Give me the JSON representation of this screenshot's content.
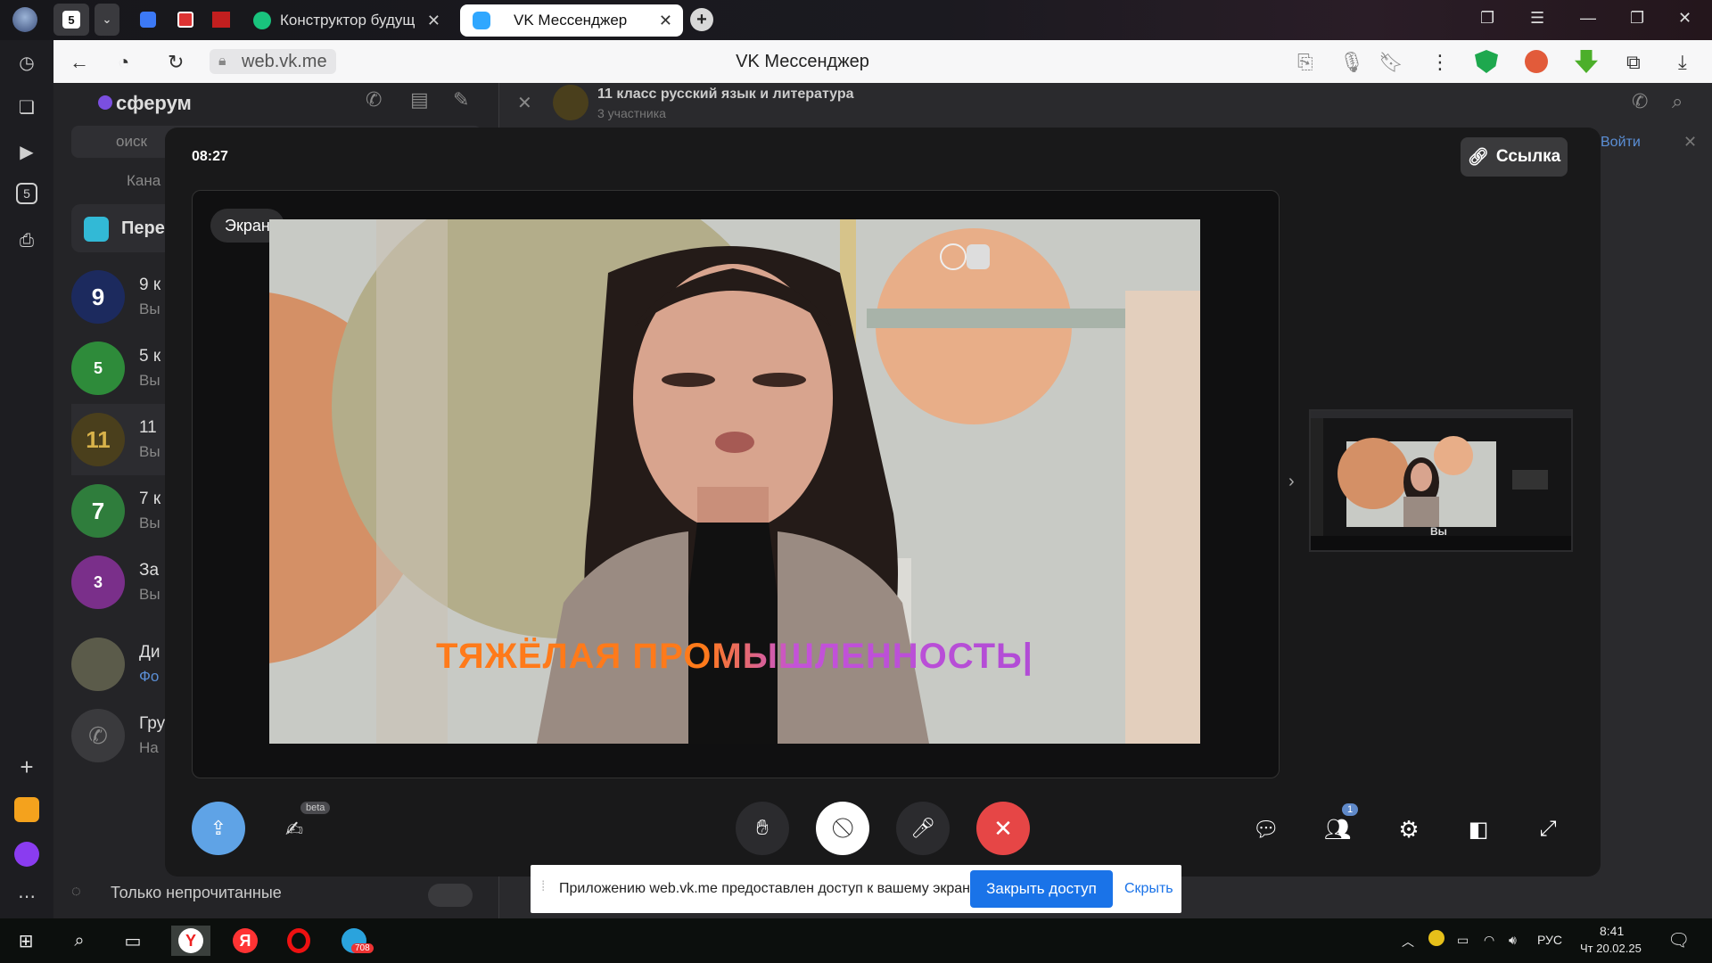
{
  "browser": {
    "tab_counter": "5",
    "tabs": [
      {
        "label": "Конструктор будущ",
        "active": false
      },
      {
        "label": "VK Мессенджер",
        "active": true
      }
    ],
    "address": "web.vk.me",
    "page_title": "VK Мессенджер"
  },
  "vk": {
    "brand": "сферум",
    "search_placeholder": "оиск",
    "chat_title": "11 класс русский язык и литература",
    "chat_members": "3 участника",
    "login_label": "Войти",
    "left_items": [
      {
        "title": "Кана",
        "sub": ""
      },
      {
        "title": "Пере",
        "sub": ""
      }
    ],
    "chats": [
      {
        "avatar": "9",
        "title": "9 к",
        "sub": "Вы",
        "color": "#1c2a5e"
      },
      {
        "avatar": "5",
        "title": "5 к",
        "sub": "Вы",
        "color": "#2e8b3a"
      },
      {
        "avatar": "11",
        "title": "11",
        "sub": "Вы",
        "color": "#4a3f1c"
      },
      {
        "avatar": "7",
        "title": "7 к",
        "sub": "Вы",
        "color": "#2f7d3c"
      },
      {
        "avatar": "3",
        "title": "За",
        "sub": "Вы",
        "color": "#7a2f8a"
      },
      {
        "avatar": "",
        "title": "Ди",
        "sub": "Фо",
        "color": "#5b5b4a"
      },
      {
        "avatar": "",
        "title": "Гру",
        "sub": "На",
        "color": "#3a3a3d"
      }
    ],
    "unread_only": "Только непрочитанные"
  },
  "call": {
    "timer": "08:27",
    "link_label": "Ссылка",
    "screen_label": "Экран",
    "video_subtitle": "ТЯЖЁЛАЯ ПРОМЫШЛЕННОСТЬ|",
    "thumb_label": "Вы",
    "beta_badge": "beta",
    "participants_count": "1"
  },
  "share_notice": {
    "text": "Приложению web.vk.me предоставлен доступ к вашему экрану.",
    "stop_label": "Закрыть доступ",
    "hide_label": "Скрыть"
  },
  "taskbar": {
    "telegram_badge": "708",
    "lang": "РУС",
    "time": "8:41",
    "date": "Чт 20.02.25"
  },
  "colors": {
    "end_call": "#e64646",
    "accent_blue": "#5fa3e6",
    "vk_purple": "#7b4fe0",
    "subtitle_orange": "#ff7a1a",
    "subtitle_purple": "#b14cd6"
  }
}
